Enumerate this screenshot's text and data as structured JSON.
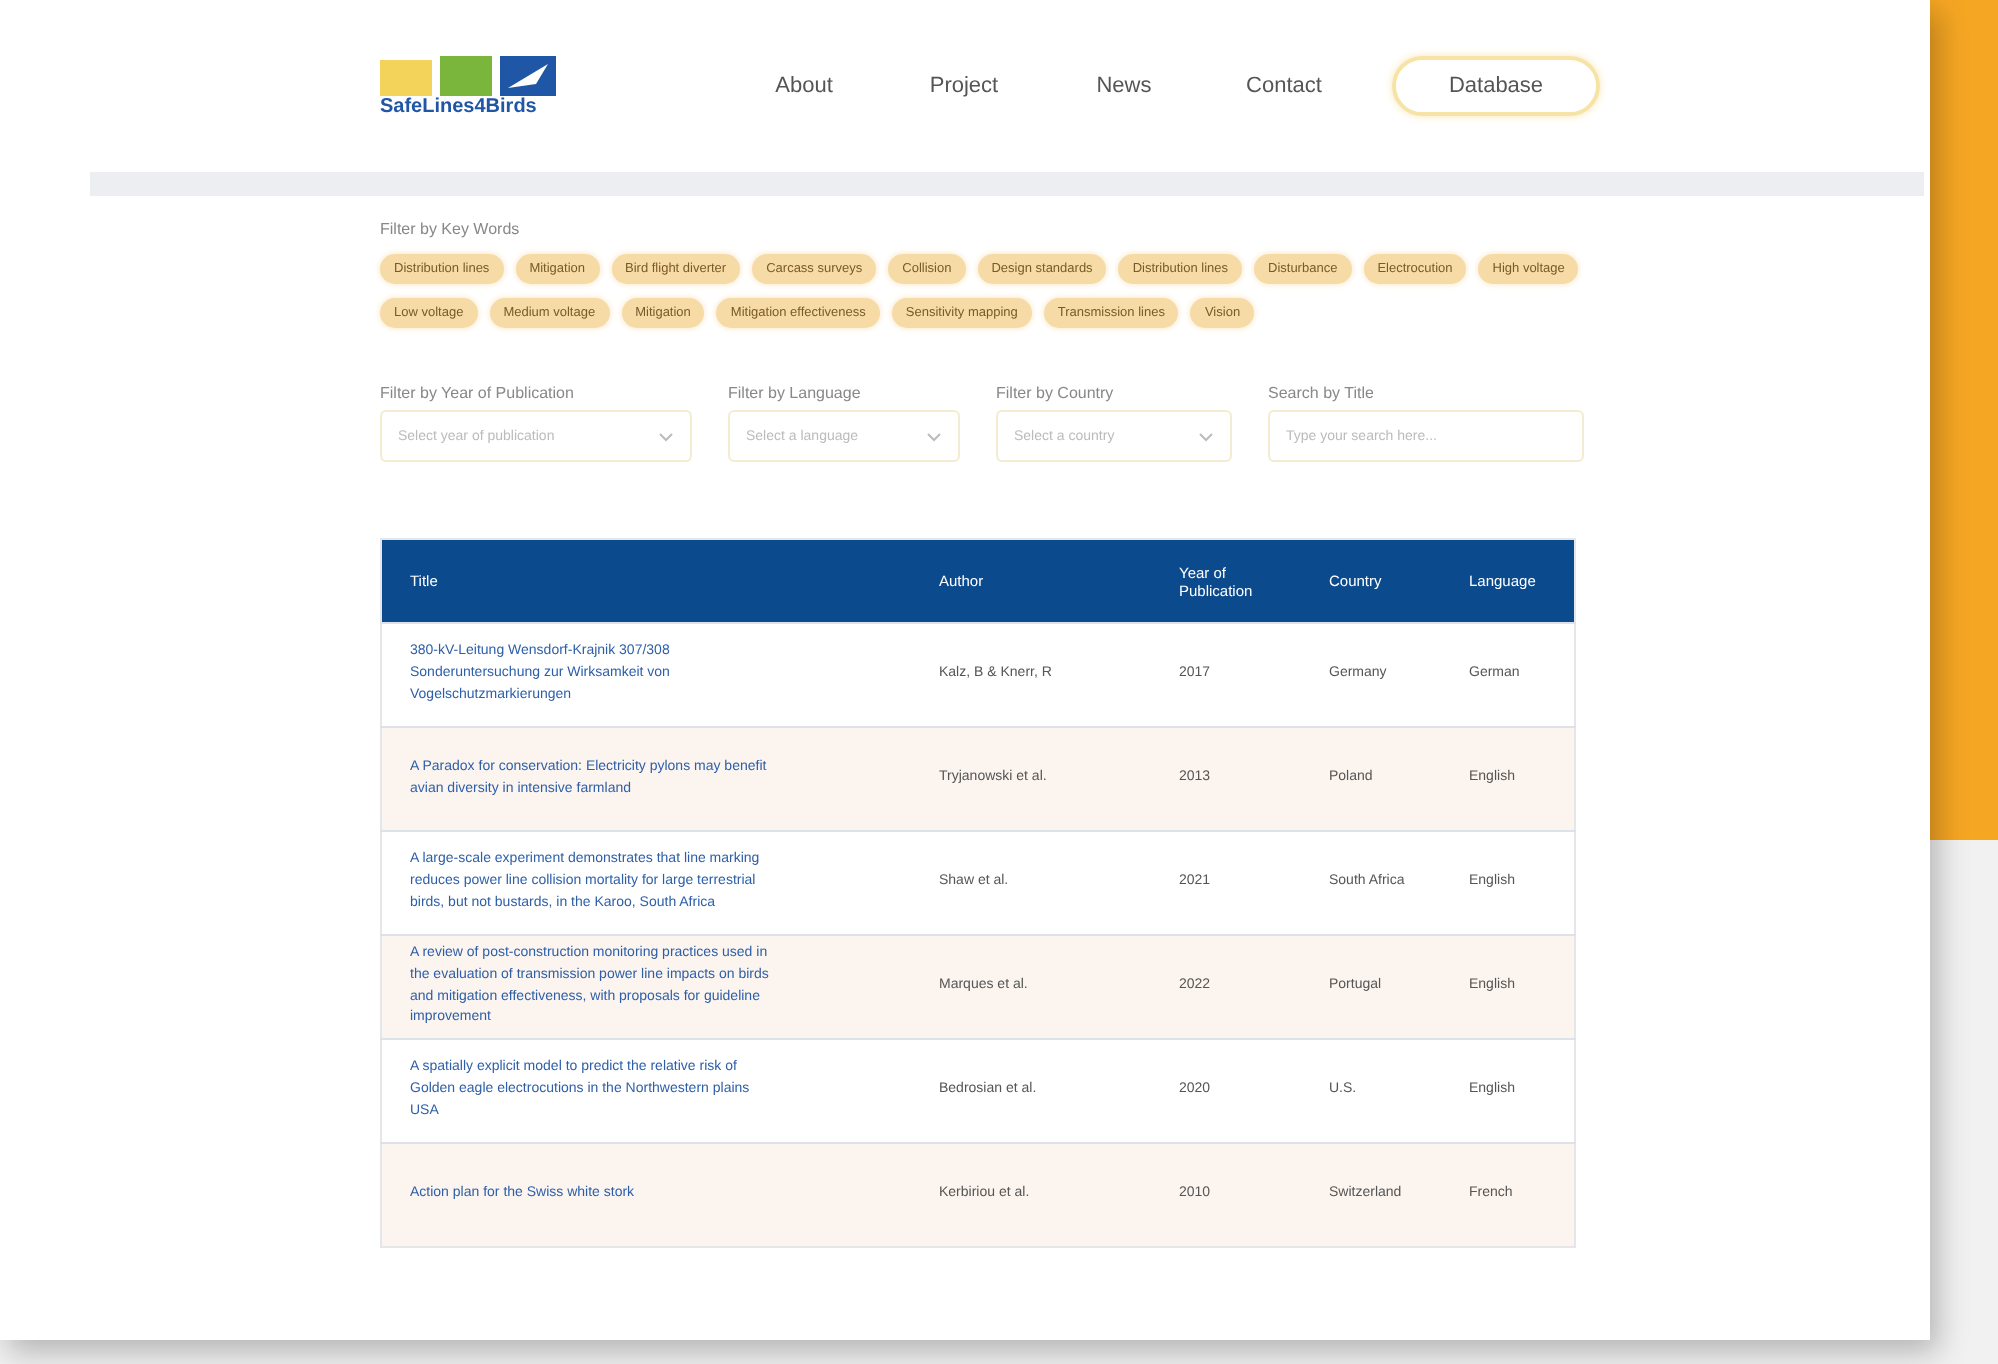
{
  "header": {
    "logo_text": "SafeLines4Birds",
    "nav": [
      {
        "label": "About",
        "selected": false
      },
      {
        "label": "Project",
        "selected": false
      },
      {
        "label": "News",
        "selected": false
      },
      {
        "label": "Contact",
        "selected": false
      },
      {
        "label": "Database",
        "selected": true
      }
    ]
  },
  "keywords": {
    "label": "Filter by Key Words",
    "tags": [
      "Distribution lines",
      "Mitigation",
      "Bird flight diverter",
      "Carcass surveys",
      "Collision",
      "Design standards",
      "Distribution lines",
      "Disturbance",
      "Electrocution",
      "High voltage",
      "Low voltage",
      "Medium voltage",
      "Mitigation",
      "Mitigation effectiveness",
      "Sensitivity mapping",
      "Transmission lines",
      "Vision"
    ]
  },
  "filters": [
    {
      "kind": "select",
      "label": "Filter by Year of Publication",
      "placeholder": "Select year of publication"
    },
    {
      "kind": "select",
      "label": "Filter by Language",
      "placeholder": "Select a language"
    },
    {
      "kind": "select",
      "label": "Filter by Country",
      "placeholder": "Select a country"
    },
    {
      "kind": "search",
      "label": "Search by Title",
      "placeholder": "Type your search here..."
    }
  ],
  "table": {
    "columns": [
      "Title",
      "Author",
      "Year of Publication",
      "Country",
      "Language"
    ],
    "rows": [
      [
        "380-kV-Leitung Wensdorf-Krajnik 307/308 Sonderuntersuchung zur Wirksamkeit von Vogelschutzmarkierungen",
        "Kalz, B & Knerr, R",
        "2017",
        "Germany",
        "German"
      ],
      [
        "A Paradox for conservation: Electricity pylons may benefit avian diversity in intensive farmland",
        "Tryjanowski et al.",
        "2013",
        "Poland",
        "English"
      ],
      [
        "A large-scale experiment demonstrates that line marking reduces power line collision mortality for large terrestrial birds, but not bustards, in the Karoo, South Africa",
        "Shaw et al.",
        "2021",
        "South Africa",
        "English"
      ],
      [
        "A review of post-construction monitoring practices used in the evaluation of transmission power line impacts on birds and mitigation effectiveness, with proposals for guideline improvement",
        "Marques et al.",
        "2022",
        "Portugal",
        "English"
      ],
      [
        "A spatially explicit model to predict the relative risk of Golden eagle electrocutions in the Northwestern plains USA",
        "Bedrosian et al.",
        "2020",
        "U.S.",
        "English"
      ],
      [
        "Action plan for the Swiss white stork",
        "Kerbiriou et al.",
        "2010",
        "Switzerland",
        "French"
      ]
    ]
  }
}
